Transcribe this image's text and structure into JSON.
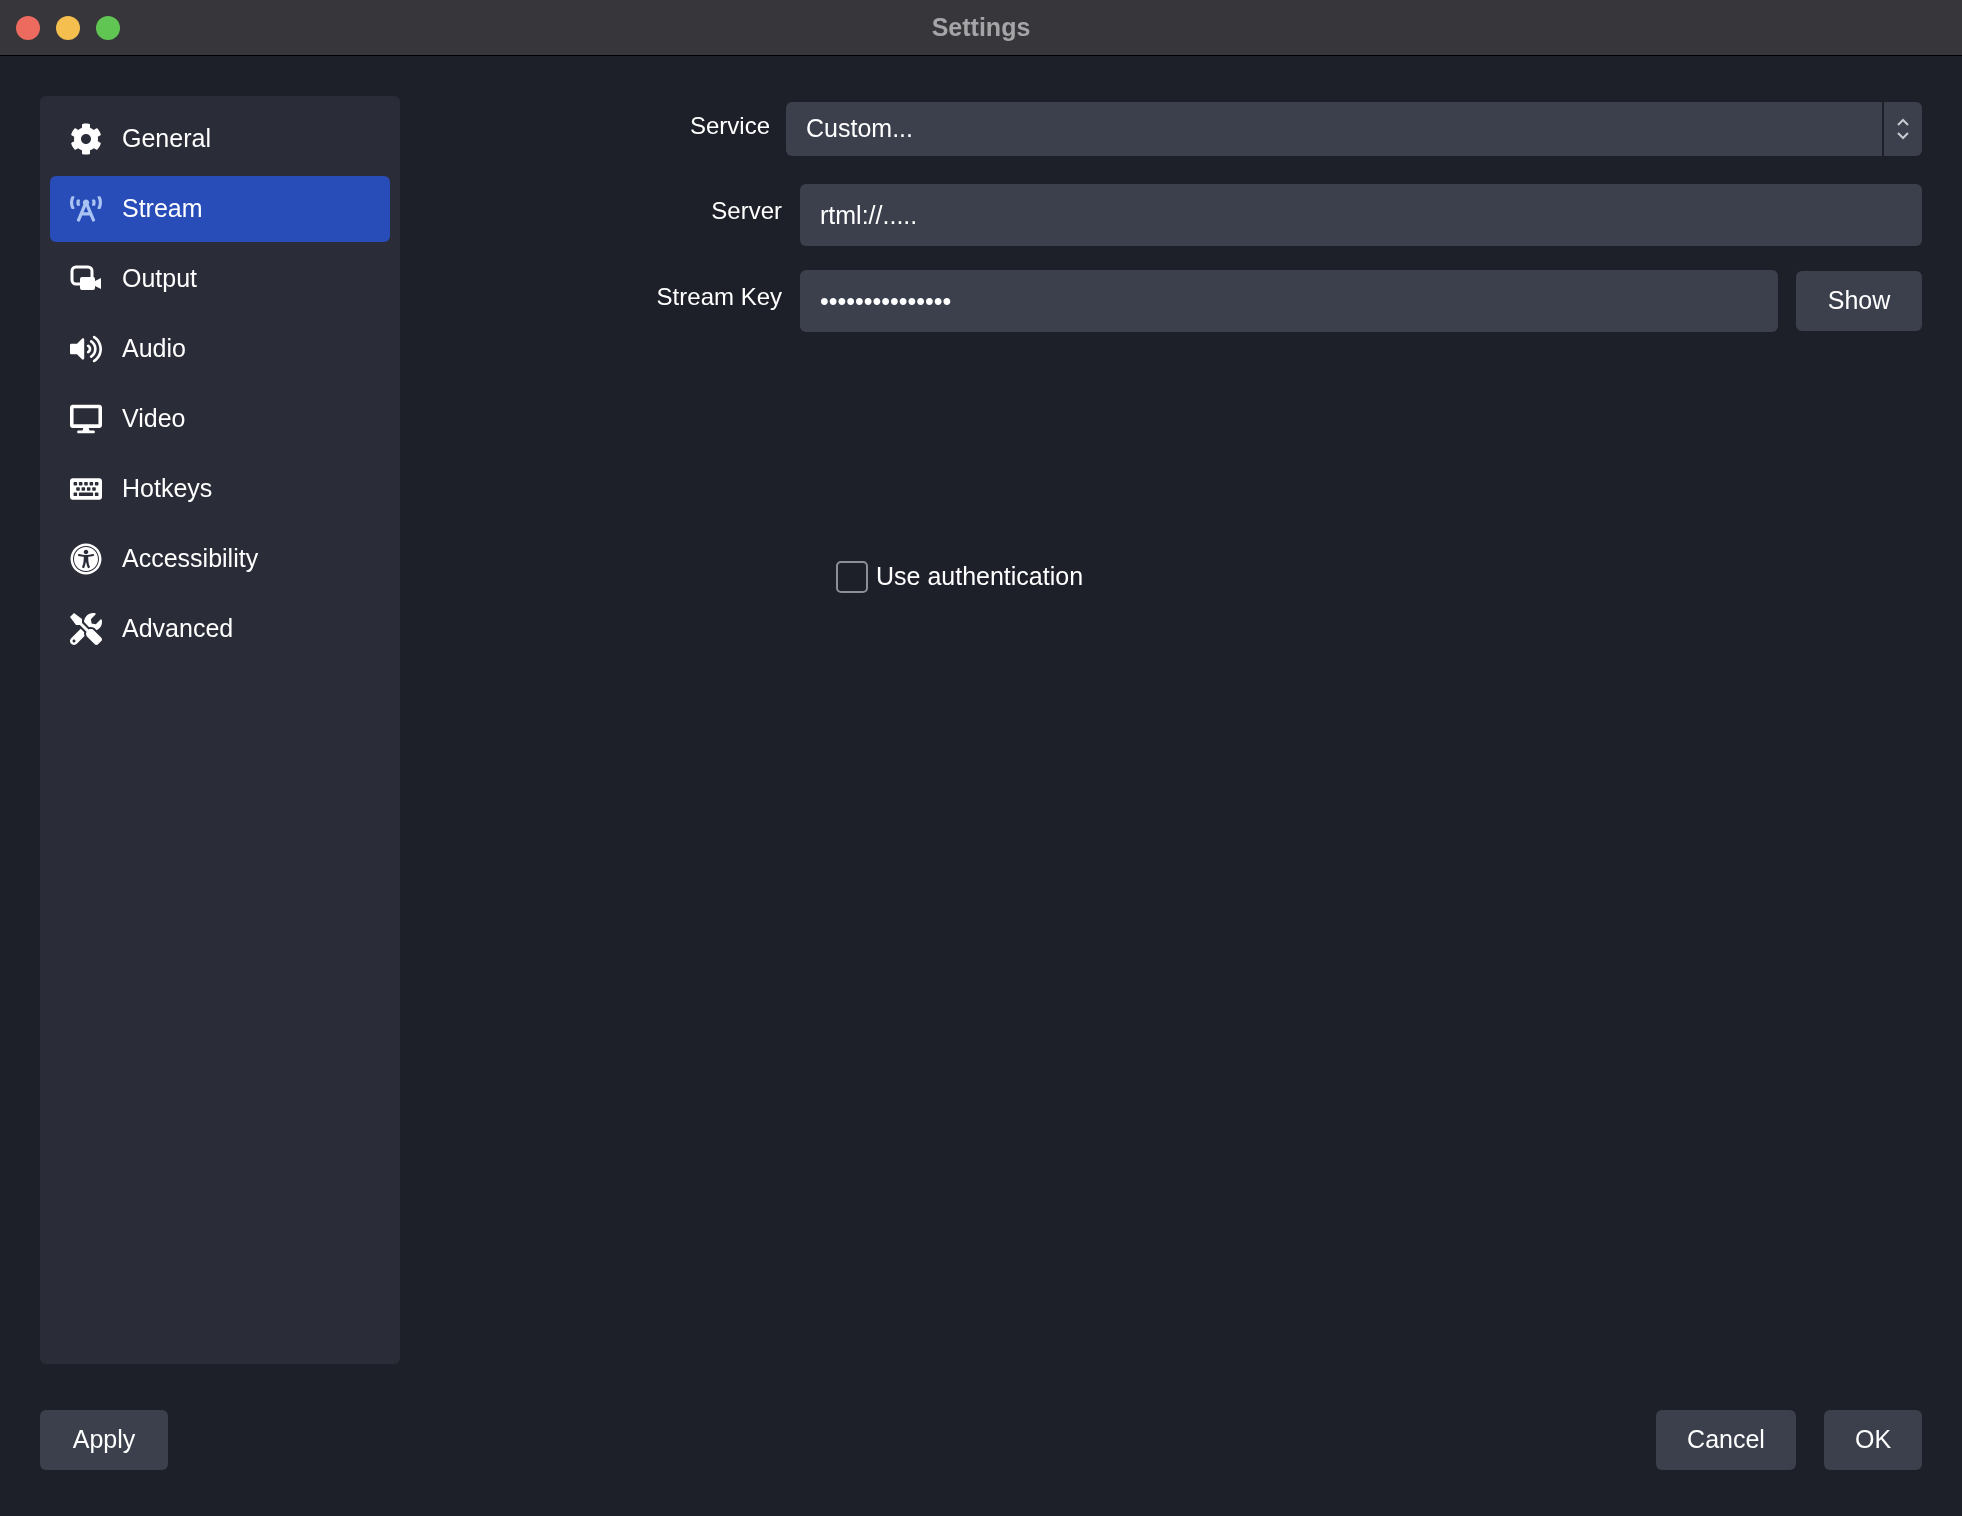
{
  "window": {
    "title": "Settings"
  },
  "sidebar": {
    "items": [
      {
        "label": "General",
        "selected": false
      },
      {
        "label": "Stream",
        "selected": true
      },
      {
        "label": "Output",
        "selected": false
      },
      {
        "label": "Audio",
        "selected": false
      },
      {
        "label": "Video",
        "selected": false
      },
      {
        "label": "Hotkeys",
        "selected": false
      },
      {
        "label": "Accessibility",
        "selected": false
      },
      {
        "label": "Advanced",
        "selected": false
      }
    ]
  },
  "form": {
    "service": {
      "label": "Service",
      "value": "Custom..."
    },
    "server": {
      "label": "Server",
      "value": "rtml://....."
    },
    "stream_key": {
      "label": "Stream Key",
      "value": "•••••••••••••••",
      "button": "Show"
    },
    "use_authentication": {
      "label": "Use authentication",
      "checked": false
    }
  },
  "footer": {
    "apply": "Apply",
    "cancel": "Cancel",
    "ok": "OK"
  }
}
